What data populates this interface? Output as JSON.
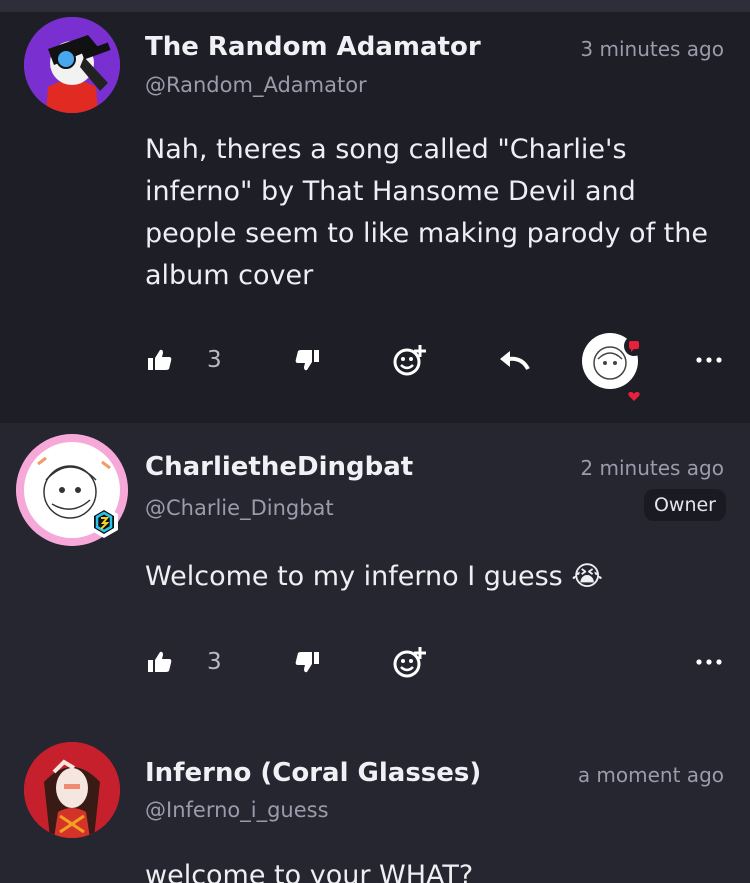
{
  "comments": [
    {
      "name": "The Random Adamator",
      "handle": "@Random_Adamator",
      "time": "3 minutes ago",
      "text": "Nah, theres a song called \"Charlie's inferno\" by That Hansome Devil and people seem to like making parody of the album cover",
      "likes": "3",
      "avatar_color": "#7a2fd0"
    },
    {
      "name": "CharlietheDingbat",
      "handle": "@Charlie_Dingbat",
      "time": "2 minutes ago",
      "badge": "Owner",
      "text": "Welcome to my inferno I guess 😭",
      "likes": "3",
      "avatar_color": "#f6a8d8"
    },
    {
      "name": "Inferno (Coral Glasses)",
      "handle": "@Inferno_i_guess",
      "time": "a moment ago",
      "text": "welcome to your WHAT?",
      "avatar_color": "#c7202d"
    }
  ],
  "icons": {
    "like": "thumbs-up-icon",
    "dislike": "thumbs-down-icon",
    "react": "add-reaction-icon",
    "reply": "reply-icon",
    "more": "more-options-icon"
  },
  "colors": {
    "background": "#262631",
    "highlight_comment": "#1e1e26",
    "reaction_red": "#e8203b"
  }
}
